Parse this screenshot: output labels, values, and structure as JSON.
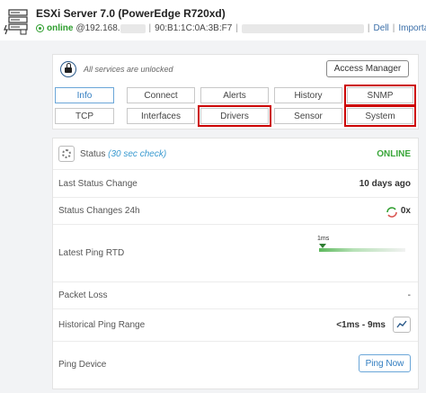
{
  "header": {
    "title": "ESXi Server 7.0 (PowerEdge R720xd)",
    "status": "online",
    "ip_prefix": "@192.168.",
    "separator": "|",
    "mac": "90:B1:1C:0A:3B:F7",
    "vendor_link": "Dell",
    "important_link": "Important"
  },
  "services": {
    "message": "All services are unlocked",
    "access_button": "Access Manager"
  },
  "tabs": [
    {
      "label": "Info",
      "active": true
    },
    {
      "label": "Connect"
    },
    {
      "label": "Alerts"
    },
    {
      "label": "History"
    },
    {
      "label": "SNMP",
      "highlighted": true
    },
    {
      "label": "TCP"
    },
    {
      "label": "Interfaces"
    },
    {
      "label": "Drivers",
      "highlighted": true
    },
    {
      "label": "Sensor"
    },
    {
      "label": "System",
      "highlighted": true
    }
  ],
  "status": {
    "label": "Status",
    "sub": "(30 sec check)",
    "value": "ONLINE",
    "last_change_label": "Last Status Change",
    "last_change_value": "10 days ago",
    "changes_label": "Status Changes 24h",
    "changes_value": "0x",
    "ping_rtd_label": "Latest Ping RTD",
    "ping_rtd_value": "1ms",
    "packet_loss_label": "Packet Loss",
    "packet_loss_value": "-",
    "ping_range_label": "Historical Ping Range",
    "ping_range_value": "<1ms - 9ms",
    "ping_device_label": "Ping Device",
    "ping_now_button": "Ping Now"
  },
  "colors": {
    "online": "#2e9e2e",
    "highlight": "#cc0000",
    "accent": "#2f7cc0"
  }
}
